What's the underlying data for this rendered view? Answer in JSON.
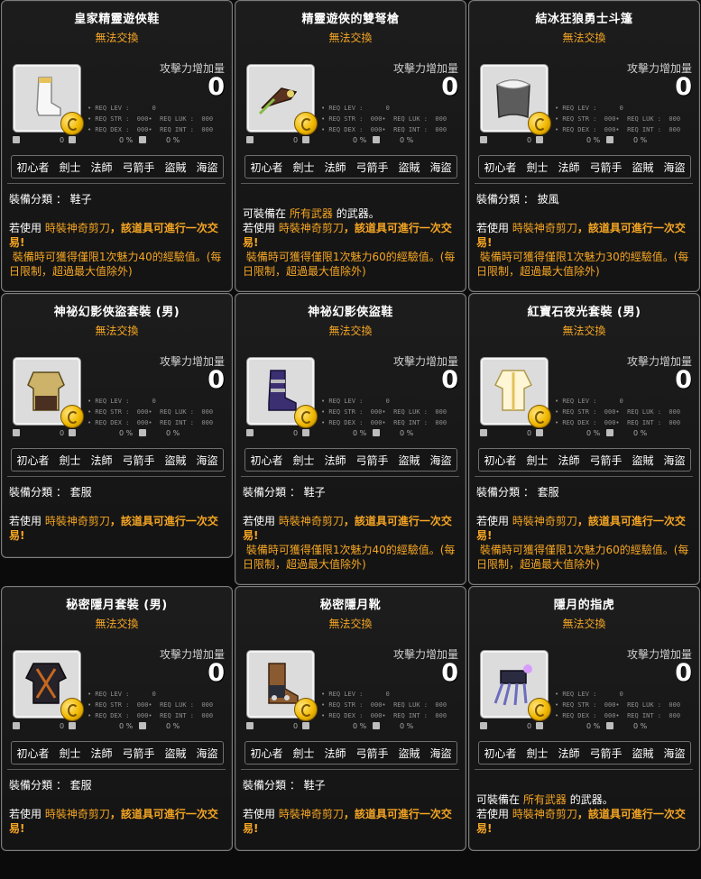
{
  "colors": {
    "untradeable": "#f6a623",
    "card_bg": "#1e1e1e",
    "border": "#7d7d7d"
  },
  "common": {
    "untradeable": "無法交換",
    "atk_label": "攻擊力增加量",
    "atk_value": "0",
    "req_lines": [
      "• REQ LEV :      0",
      "• REQ STR :  000•  REQ LUK :  000",
      "• REQ DEX :  000•  REQ INT :  000"
    ],
    "stat_values": [
      "0",
      "0",
      "0 %",
      "0 %"
    ],
    "jobs": [
      "初心者",
      "劍士",
      "法師",
      "弓箭手",
      "盜賊",
      "海盜"
    ],
    "category_label": "裝備分類 ：",
    "if_use": "若使用",
    "scissor": "時裝神奇剪刀",
    "trade_text": "，該道具可進行一次交易!",
    "can_equip": "可裝備在",
    "all_weapons": "所有武器",
    "weapon_suffix": "的武器。",
    "exp_prefix": "裝備時可獲得僅限1次魅力",
    "exp_suffix": "的經驗值。(每日限制，超過最大值除外)"
  },
  "cards": [
    {
      "name": "皇家精靈遊俠鞋",
      "icon": "boot-icon",
      "category": "鞋子",
      "charm": "40"
    },
    {
      "name": "精靈遊俠的雙弩槍",
      "icon": "crossbow-icon",
      "category": "",
      "charm": "60"
    },
    {
      "name": "結冰狂狼勇士斗篷",
      "icon": "cape-icon",
      "category": "披風",
      "charm": "30"
    },
    {
      "name": "神祕幻影俠盜套裝 (男)",
      "icon": "armor-icon",
      "category": "套服",
      "charm": ""
    },
    {
      "name": "神祕幻影俠盜鞋",
      "icon": "boot-icon",
      "category": "鞋子",
      "charm": "40"
    },
    {
      "name": "紅寶石夜光套裝 (男)",
      "icon": "robe-icon",
      "category": "套服",
      "charm": "60"
    },
    {
      "name": "秘密隱月套裝 (男)",
      "icon": "armor-icon",
      "category": "套服",
      "charm": ""
    },
    {
      "name": "秘密隱月靴",
      "icon": "boot-icon",
      "category": "鞋子",
      "charm": ""
    },
    {
      "name": "隱月的指虎",
      "icon": "claw-icon",
      "category": "",
      "charm": ""
    }
  ]
}
